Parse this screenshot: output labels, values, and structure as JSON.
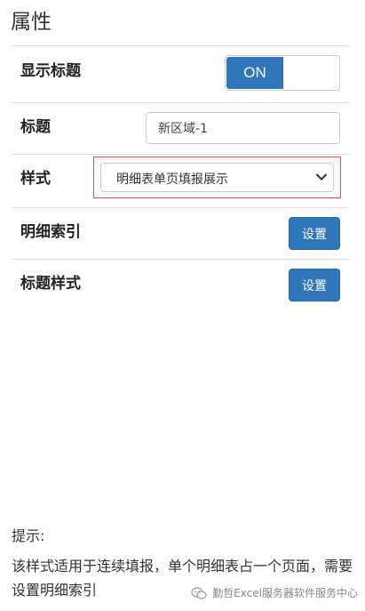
{
  "panel": {
    "title": "属性"
  },
  "rows": {
    "show_title": {
      "label": "显示标题",
      "toggle_on_label": "ON",
      "toggle_state": "on"
    },
    "title": {
      "label": "标题",
      "value": "新区域-1"
    },
    "style": {
      "label": "样式",
      "selected": "明细表单页填报展示"
    },
    "detail_index": {
      "label": "明细索引",
      "button_label": "设置"
    },
    "title_style": {
      "label": "标题样式",
      "button_label": "设置"
    }
  },
  "hint": {
    "title": "提示:",
    "text": "该样式适用于连续填报，单个明细表占一个页面，需要设置明细索引"
  },
  "watermark": {
    "text": "勤哲Excel服务器软件服务中心",
    "icon": "wechat-icon"
  },
  "colors": {
    "primary": "#2f76bb",
    "highlight_border": "#d9534f"
  }
}
